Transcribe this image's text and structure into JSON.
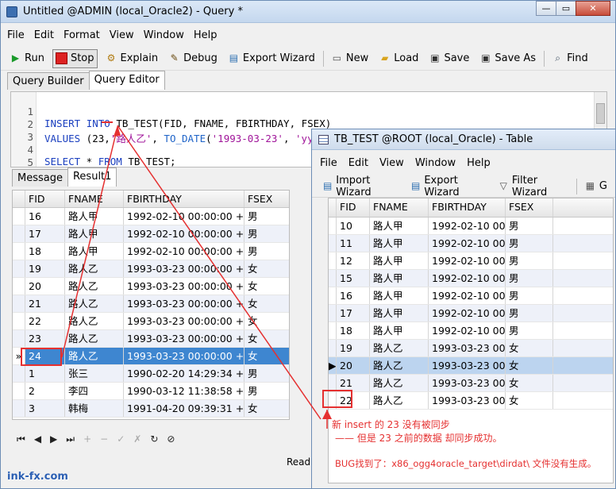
{
  "main_window": {
    "title": "Untitled @ADMIN (local_Oracle2) - Query *",
    "window_buttons": [
      "—",
      "▭",
      "✕"
    ],
    "menu": [
      "File",
      "Edit",
      "Format",
      "View",
      "Window",
      "Help"
    ],
    "toolbar": [
      {
        "label": "Run",
        "icon": "play-icon"
      },
      {
        "label": "Stop",
        "icon": "stop-icon"
      },
      {
        "label": "Explain",
        "icon": "explain-icon"
      },
      {
        "label": "Debug",
        "icon": "debug-icon"
      },
      {
        "label": "Export Wizard",
        "icon": "export-icon"
      },
      {
        "label": "New",
        "icon": "new-icon"
      },
      {
        "label": "Load",
        "icon": "folder-icon"
      },
      {
        "label": "Save",
        "icon": "save-icon"
      },
      {
        "label": "Save As",
        "icon": "save-as-icon"
      },
      {
        "label": "Find",
        "icon": "search-icon"
      }
    ],
    "tabs": [
      "Query Builder",
      "Query Editor"
    ],
    "editor_lines": [
      {
        "n": "1",
        "code": "INSERT INTO TB_TEST(FID, FNAME, FBIRTHDAY, FSEX)"
      },
      {
        "n": "2",
        "code": "VALUES (23,'路人乙', TO_DATE('1993-03-23', 'yyyy-MM-dd'),'女');"
      },
      {
        "n": "3",
        "code": ""
      },
      {
        "n": "4",
        "code": "SELECT * FROM TB_TEST;"
      },
      {
        "n": "5",
        "code": ""
      },
      {
        "n": "6",
        "code": ""
      }
    ],
    "result_tabs": [
      "Message",
      "Result1"
    ],
    "columns": [
      "FID",
      "FNAME",
      "FBIRTHDAY",
      "FSEX"
    ],
    "rows": [
      [
        "16",
        "路人甲",
        "1992-02-10 00:00:00 +08",
        "男"
      ],
      [
        "17",
        "路人甲",
        "1992-02-10 00:00:00 +08",
        "男"
      ],
      [
        "18",
        "路人甲",
        "1992-02-10 00:00:00 +08",
        "男"
      ],
      [
        "19",
        "路人乙",
        "1993-03-23 00:00:00 +08",
        "女"
      ],
      [
        "20",
        "路人乙",
        "1993-03-23 00:00:00 +08",
        "女"
      ],
      [
        "21",
        "路人乙",
        "1993-03-23 00:00:00 +08",
        "女"
      ],
      [
        "22",
        "路人乙",
        "1993-03-23 00:00:00 +08",
        "女"
      ],
      [
        "23",
        "路人乙",
        "1993-03-23 00:00:00 +08",
        "女"
      ],
      [
        "24",
        "路人乙",
        "1993-03-23 00:00:00 +08",
        "女"
      ],
      [
        "1",
        "张三",
        "1990-02-20 14:29:34 +08",
        "男"
      ],
      [
        "2",
        "李四",
        "1990-03-12 11:38:58 +08",
        "男"
      ],
      [
        "3",
        "韩梅",
        "1991-04-20 09:39:31 +08",
        "女"
      ]
    ],
    "selected_row_marker": "»",
    "nav_buttons": [
      "⏮",
      "◀",
      "▶",
      "⏭",
      "+",
      "−",
      "✓",
      "✗",
      "↻",
      "⊘"
    ],
    "status": "Read",
    "watermark": "ink-fx.com"
  },
  "table_window": {
    "title": "TB_TEST @ROOT (local_Oracle) - Table",
    "menu": [
      "File",
      "Edit",
      "View",
      "Window",
      "Help"
    ],
    "toolbar": [
      {
        "label": "Import Wizard",
        "icon": "import-icon"
      },
      {
        "label": "Export Wizard",
        "icon": "export-icon"
      },
      {
        "label": "Filter Wizard",
        "icon": "filter-icon"
      },
      {
        "label": "G",
        "icon": "grid-icon"
      }
    ],
    "columns": [
      "FID",
      "FNAME",
      "FBIRTHDAY",
      "FSEX"
    ],
    "rows": [
      [
        "10",
        "路人甲",
        "1992-02-10 00:",
        "男"
      ],
      [
        "11",
        "路人甲",
        "1992-02-10 00:",
        "男"
      ],
      [
        "12",
        "路人甲",
        "1992-02-10 00:",
        "男"
      ],
      [
        "15",
        "路人甲",
        "1992-02-10 00:",
        "男"
      ],
      [
        "16",
        "路人甲",
        "1992-02-10 00:",
        "男"
      ],
      [
        "17",
        "路人甲",
        "1992-02-10 00:",
        "男"
      ],
      [
        "18",
        "路人甲",
        "1992-02-10 00:",
        "男"
      ],
      [
        "19",
        "路人乙",
        "1993-03-23 00:",
        "女"
      ],
      [
        "20",
        "路人乙",
        "1993-03-23 00:",
        "女"
      ],
      [
        "21",
        "路人乙",
        "1993-03-23 00:",
        "女"
      ],
      [
        "22",
        "路人乙",
        "1993-03-23 00:",
        "女"
      ]
    ],
    "selected_row_marker": "▶"
  },
  "annotations": {
    "line1": "新 insert 的 23 没有被同步",
    "line2": "—— 但是 23 之前的数据 却同步成功。",
    "line3": "BUG找到了：x86_ogg4oracle_target\\dirdat\\ 文件没有生成。"
  },
  "colors": {
    "annotation": "#e53030",
    "selection": "#3e86d0",
    "keyword": "#1a3fbf",
    "string": "#a0159a"
  }
}
